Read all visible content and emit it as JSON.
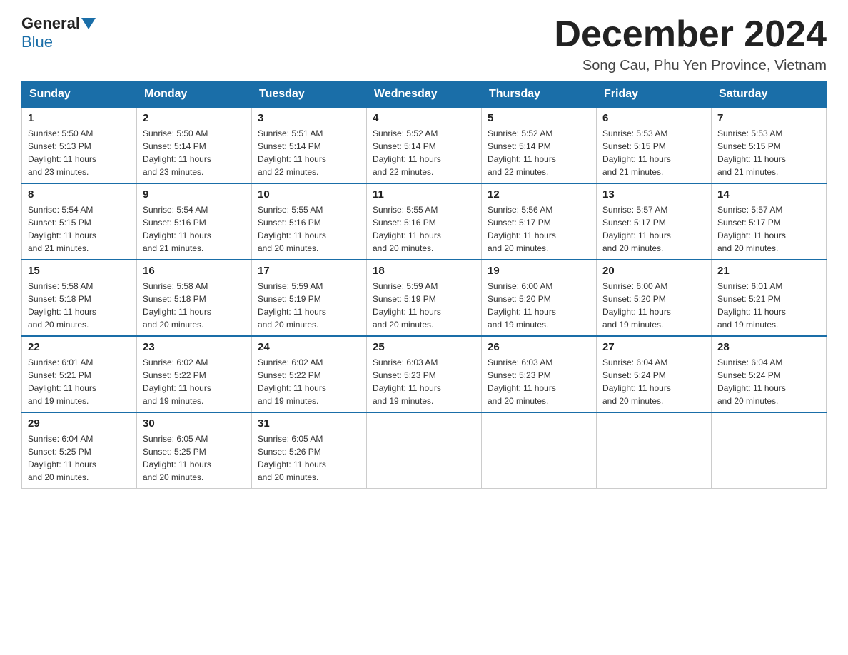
{
  "header": {
    "logo_general": "General",
    "logo_blue": "Blue",
    "month_year": "December 2024",
    "location": "Song Cau, Phu Yen Province, Vietnam"
  },
  "days_of_week": [
    "Sunday",
    "Monday",
    "Tuesday",
    "Wednesday",
    "Thursday",
    "Friday",
    "Saturday"
  ],
  "weeks": [
    [
      {
        "day": 1,
        "sunrise": "5:50 AM",
        "sunset": "5:13 PM",
        "daylight": "11 hours and 23 minutes."
      },
      {
        "day": 2,
        "sunrise": "5:50 AM",
        "sunset": "5:14 PM",
        "daylight": "11 hours and 23 minutes."
      },
      {
        "day": 3,
        "sunrise": "5:51 AM",
        "sunset": "5:14 PM",
        "daylight": "11 hours and 22 minutes."
      },
      {
        "day": 4,
        "sunrise": "5:52 AM",
        "sunset": "5:14 PM",
        "daylight": "11 hours and 22 minutes."
      },
      {
        "day": 5,
        "sunrise": "5:52 AM",
        "sunset": "5:14 PM",
        "daylight": "11 hours and 22 minutes."
      },
      {
        "day": 6,
        "sunrise": "5:53 AM",
        "sunset": "5:15 PM",
        "daylight": "11 hours and 21 minutes."
      },
      {
        "day": 7,
        "sunrise": "5:53 AM",
        "sunset": "5:15 PM",
        "daylight": "11 hours and 21 minutes."
      }
    ],
    [
      {
        "day": 8,
        "sunrise": "5:54 AM",
        "sunset": "5:15 PM",
        "daylight": "11 hours and 21 minutes."
      },
      {
        "day": 9,
        "sunrise": "5:54 AM",
        "sunset": "5:16 PM",
        "daylight": "11 hours and 21 minutes."
      },
      {
        "day": 10,
        "sunrise": "5:55 AM",
        "sunset": "5:16 PM",
        "daylight": "11 hours and 20 minutes."
      },
      {
        "day": 11,
        "sunrise": "5:55 AM",
        "sunset": "5:16 PM",
        "daylight": "11 hours and 20 minutes."
      },
      {
        "day": 12,
        "sunrise": "5:56 AM",
        "sunset": "5:17 PM",
        "daylight": "11 hours and 20 minutes."
      },
      {
        "day": 13,
        "sunrise": "5:57 AM",
        "sunset": "5:17 PM",
        "daylight": "11 hours and 20 minutes."
      },
      {
        "day": 14,
        "sunrise": "5:57 AM",
        "sunset": "5:17 PM",
        "daylight": "11 hours and 20 minutes."
      }
    ],
    [
      {
        "day": 15,
        "sunrise": "5:58 AM",
        "sunset": "5:18 PM",
        "daylight": "11 hours and 20 minutes."
      },
      {
        "day": 16,
        "sunrise": "5:58 AM",
        "sunset": "5:18 PM",
        "daylight": "11 hours and 20 minutes."
      },
      {
        "day": 17,
        "sunrise": "5:59 AM",
        "sunset": "5:19 PM",
        "daylight": "11 hours and 20 minutes."
      },
      {
        "day": 18,
        "sunrise": "5:59 AM",
        "sunset": "5:19 PM",
        "daylight": "11 hours and 20 minutes."
      },
      {
        "day": 19,
        "sunrise": "6:00 AM",
        "sunset": "5:20 PM",
        "daylight": "11 hours and 19 minutes."
      },
      {
        "day": 20,
        "sunrise": "6:00 AM",
        "sunset": "5:20 PM",
        "daylight": "11 hours and 19 minutes."
      },
      {
        "day": 21,
        "sunrise": "6:01 AM",
        "sunset": "5:21 PM",
        "daylight": "11 hours and 19 minutes."
      }
    ],
    [
      {
        "day": 22,
        "sunrise": "6:01 AM",
        "sunset": "5:21 PM",
        "daylight": "11 hours and 19 minutes."
      },
      {
        "day": 23,
        "sunrise": "6:02 AM",
        "sunset": "5:22 PM",
        "daylight": "11 hours and 19 minutes."
      },
      {
        "day": 24,
        "sunrise": "6:02 AM",
        "sunset": "5:22 PM",
        "daylight": "11 hours and 19 minutes."
      },
      {
        "day": 25,
        "sunrise": "6:03 AM",
        "sunset": "5:23 PM",
        "daylight": "11 hours and 19 minutes."
      },
      {
        "day": 26,
        "sunrise": "6:03 AM",
        "sunset": "5:23 PM",
        "daylight": "11 hours and 20 minutes."
      },
      {
        "day": 27,
        "sunrise": "6:04 AM",
        "sunset": "5:24 PM",
        "daylight": "11 hours and 20 minutes."
      },
      {
        "day": 28,
        "sunrise": "6:04 AM",
        "sunset": "5:24 PM",
        "daylight": "11 hours and 20 minutes."
      }
    ],
    [
      {
        "day": 29,
        "sunrise": "6:04 AM",
        "sunset": "5:25 PM",
        "daylight": "11 hours and 20 minutes."
      },
      {
        "day": 30,
        "sunrise": "6:05 AM",
        "sunset": "5:25 PM",
        "daylight": "11 hours and 20 minutes."
      },
      {
        "day": 31,
        "sunrise": "6:05 AM",
        "sunset": "5:26 PM",
        "daylight": "11 hours and 20 minutes."
      },
      null,
      null,
      null,
      null
    ]
  ],
  "labels": {
    "sunrise": "Sunrise:",
    "sunset": "Sunset:",
    "daylight": "Daylight:"
  }
}
